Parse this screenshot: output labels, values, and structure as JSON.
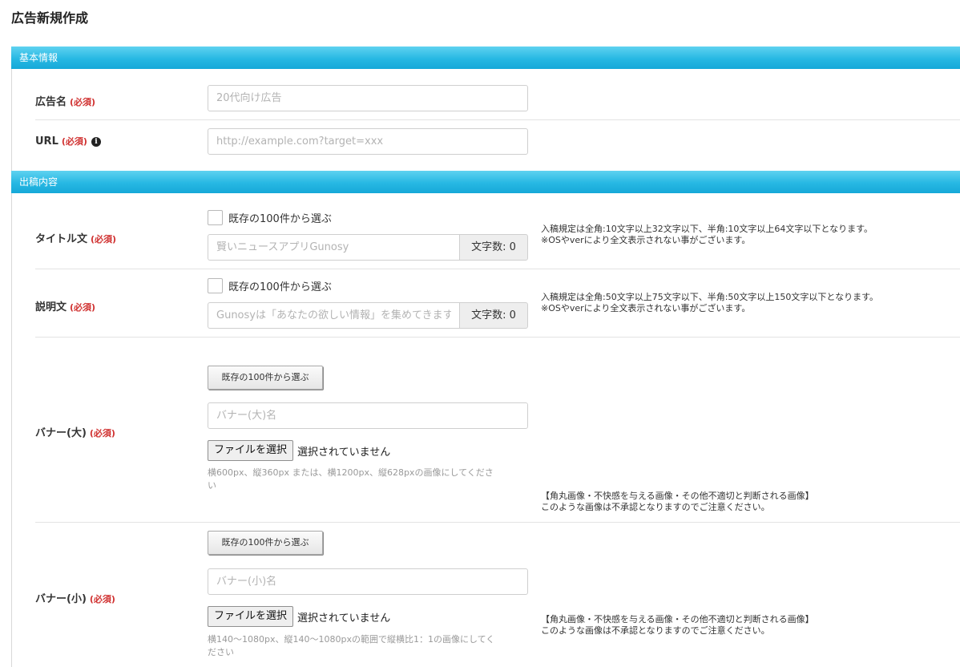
{
  "page": {
    "title": "広告新規作成"
  },
  "sections": {
    "basic": {
      "label": "基本情報"
    },
    "content": {
      "label": "出稿内容"
    }
  },
  "required_label": "(必須)",
  "fields": {
    "ad_name": {
      "label": "広告名",
      "placeholder": "20代向け広告"
    },
    "url": {
      "label": "URL",
      "placeholder": "http://example.com?target=xxx",
      "info_icon": "i"
    },
    "title": {
      "label": "タイトル文",
      "checkbox_label": "既存の100件から選ぶ",
      "placeholder": "賢いニュースアプリGunosy",
      "char_count": "文字数: 0",
      "help_lines": [
        "入稿規定は全角:10文字以上32文字以下、半角:10文字以上64文字以下となります。",
        "※OSやverにより全文表示されない事がございます。"
      ]
    },
    "description": {
      "label": "説明文",
      "checkbox_label": "既存の100件から選ぶ",
      "placeholder": "Gunosyは「あなたの欲しい情報」を集めてきます",
      "char_count": "文字数: 0",
      "help_lines": [
        "入稿規定は全角:50文字以上75文字以下、半角:50文字以上150文字以下となります。",
        "※OSやverにより全文表示されない事がございます。"
      ]
    },
    "banner_large": {
      "label": "バナー(大)",
      "pick_button": "既存の100件から選ぶ",
      "name_placeholder": "バナー(大)名",
      "file_button": "ファイルを選択",
      "file_status": "選択されていません",
      "size_note_lines": [
        "横600px、縦360px または、横1200px、縦628pxの画像にしてくださ",
        "い"
      ],
      "warning_lines": [
        "【角丸画像・不快感を与える画像・その他不適切と判断される画像】",
        "このような画像は不承認となりますのでご注意ください。"
      ]
    },
    "banner_small": {
      "label": "バナー(小)",
      "pick_button": "既存の100件から選ぶ",
      "name_placeholder": "バナー(小)名",
      "file_button": "ファイルを選択",
      "file_status": "選択されていません",
      "size_note_lines": [
        "横140〜1080px、縦140〜1080pxの範囲で縦横比1：1の画像にしてく",
        "ださい"
      ],
      "warning_lines": [
        "【角丸画像・不快感を与える画像・その他不適切と判断される画像】",
        "このような画像は不承認となりますのでご注意ください。"
      ]
    }
  },
  "colors": {
    "section_bar": "#27b8e3",
    "required": "#d0302f"
  }
}
